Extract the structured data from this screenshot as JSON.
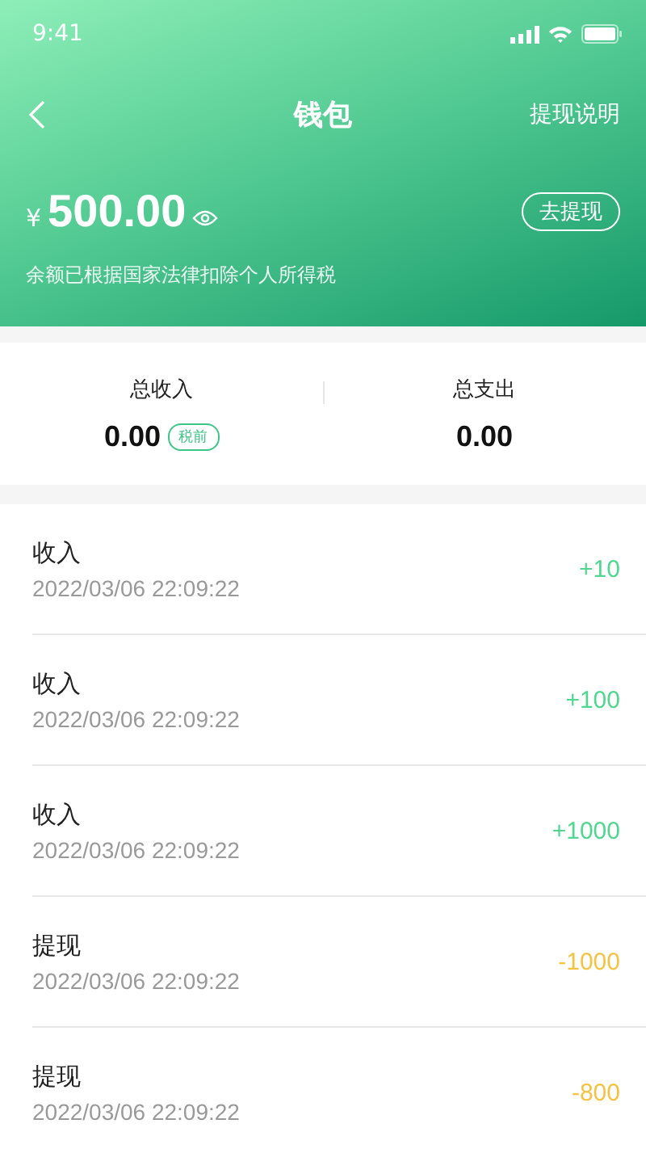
{
  "status_bar": {
    "time": "9:41"
  },
  "nav": {
    "title": "钱包",
    "action": "提现说明"
  },
  "balance": {
    "currency": "¥",
    "amount": "500.00",
    "button": "去提现",
    "note": "余额已根据国家法律扣除个人所得税"
  },
  "summary": [
    {
      "label": "总收入",
      "value": "0.00",
      "tag": "税前"
    },
    {
      "label": "总支出",
      "value": "0.00"
    }
  ],
  "records": [
    {
      "kind": "income",
      "title": "收入",
      "time": "2022/03/06 22:09:22",
      "amount": "+10"
    },
    {
      "kind": "income",
      "title": "收入",
      "time": "2022/03/06 22:09:22",
      "amount": "+100"
    },
    {
      "kind": "income",
      "title": "收入",
      "time": "2022/03/06 22:09:22",
      "amount": "+1000"
    },
    {
      "kind": "withdraw",
      "title": "提现",
      "time": "2022/03/06 22:09:22",
      "amount": "-1000"
    },
    {
      "kind": "withdraw",
      "title": "提现",
      "time": "2022/03/06 22:09:22",
      "amount": "-800"
    }
  ]
}
